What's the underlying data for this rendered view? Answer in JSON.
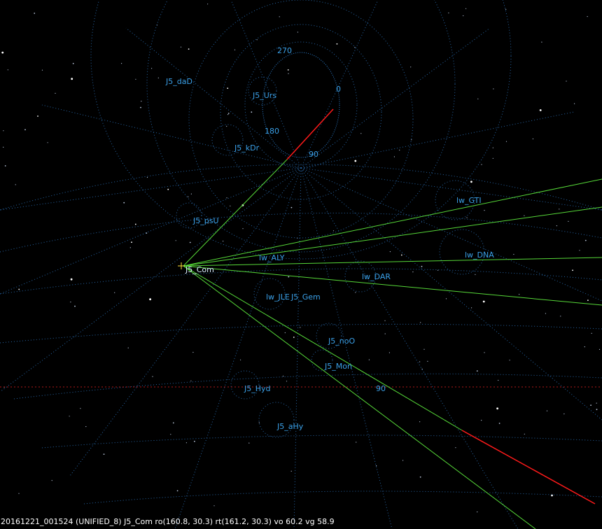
{
  "labels": [
    {
      "id": "J5_daD",
      "text": "J5_daD"
    },
    {
      "id": "J5_Urs",
      "text": "J5_Urs"
    },
    {
      "id": "J5_kDr",
      "text": "J5_kDr"
    },
    {
      "id": "J5_psU",
      "text": "J5_psU"
    },
    {
      "id": "J5_Com",
      "text": "J5_Com"
    },
    {
      "id": "lw_ALY",
      "text": "lw_ALY"
    },
    {
      "id": "lw_GTI",
      "text": "lw_GTI"
    },
    {
      "id": "lw_DNA",
      "text": "lw_DNA"
    },
    {
      "id": "lw_DAR",
      "text": "lw_DAR"
    },
    {
      "id": "lw_JLE",
      "text": "lw_JLE"
    },
    {
      "id": "J5_Gem",
      "text": "J5_Gem"
    },
    {
      "id": "J5_noO",
      "text": "J5_noO"
    },
    {
      "id": "J5_Mon",
      "text": "J5_Mon"
    },
    {
      "id": "J5_Hyd",
      "text": "J5_Hyd"
    },
    {
      "id": "J5_aHy",
      "text": "J5_aHy"
    }
  ],
  "dial_labels": {
    "d270": "270",
    "d0": "0",
    "d180": "180",
    "d90": "90",
    "horizon_90": "90"
  },
  "status_line": "20161221_001524 (UNIFIED_8) J5_Com ro(160.8, 30.3) rt(161.2, 30.3) vo 60.2 vg 58.9",
  "colors": {
    "background": "#000000",
    "grid": "#2b6fb5",
    "label": "#3aa0e8",
    "ray_green": "#56d838",
    "ray_red": "#ff1a1a",
    "horizon": "#b01818"
  }
}
